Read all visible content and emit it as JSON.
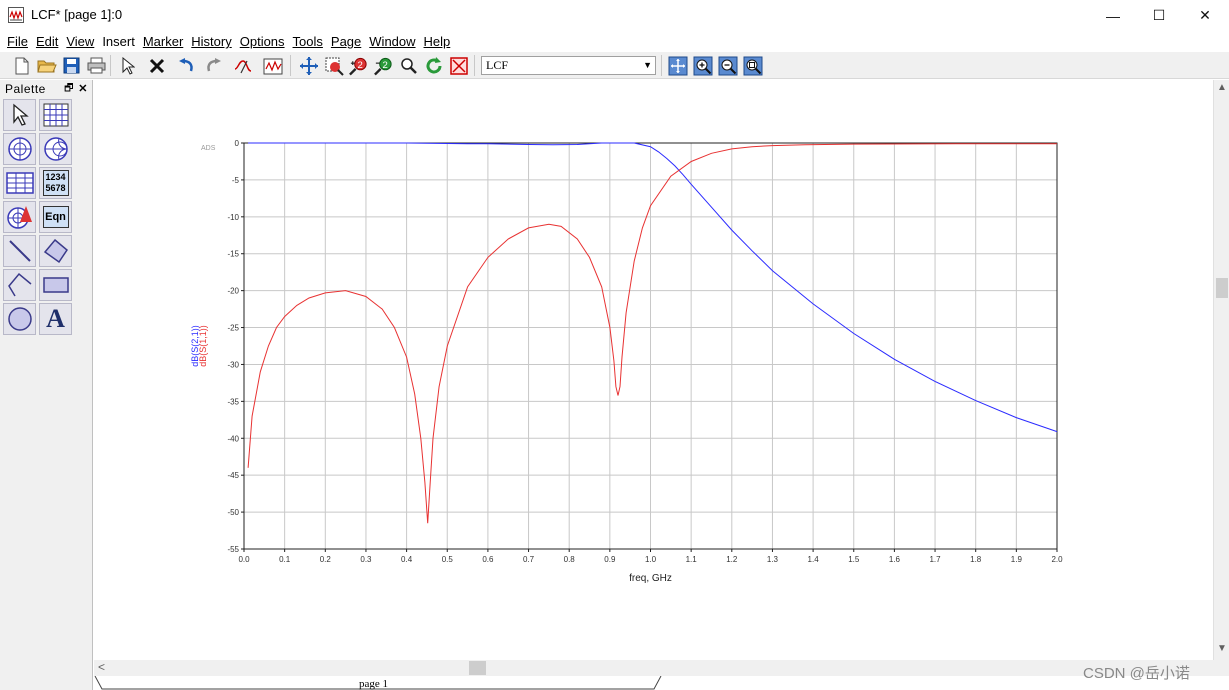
{
  "window": {
    "title": "LCF* [page 1]:0",
    "controls": {
      "minimize": "—",
      "maximize": "☐",
      "close": "✕"
    }
  },
  "menu": [
    {
      "label": "File"
    },
    {
      "label": "Edit"
    },
    {
      "label": "View"
    },
    {
      "label": "Insert"
    },
    {
      "label": "Marker"
    },
    {
      "label": "History"
    },
    {
      "label": "Options"
    },
    {
      "label": "Tools"
    },
    {
      "label": "Page"
    },
    {
      "label": "Window"
    },
    {
      "label": "Help"
    }
  ],
  "toolbar": {
    "page_select_value": "LCF",
    "buttons": [
      "new-icon",
      "open-icon",
      "save-icon",
      "print-icon",
      "select-pointer-icon",
      "delete-icon",
      "undo-icon",
      "redo-icon",
      "marker-icon",
      "plot-icon",
      "move-icon",
      "zoom-area-icon",
      "zoom-in-2-icon",
      "zoom-out-2-icon",
      "zoom-search-icon",
      "refresh-icon",
      "clear-icon",
      "view-all-icon",
      "zoom-in-icon",
      "zoom-out-icon",
      "zoom-fit-icon"
    ]
  },
  "palette": {
    "title": "Palette",
    "pin": "🗗",
    "close": "✕",
    "items": [
      {
        "name": "pointer-tool-icon"
      },
      {
        "name": "rectangular-plot-icon"
      },
      {
        "name": "polar-plot-icon"
      },
      {
        "name": "smith-chart-icon"
      },
      {
        "name": "list-table-icon"
      },
      {
        "name": "stacked-list-icon",
        "text": [
          "1234",
          "5678"
        ]
      },
      {
        "name": "antenna-plot-icon"
      },
      {
        "name": "equation-icon",
        "text": "Eqn"
      },
      {
        "name": "line-tool-icon"
      },
      {
        "name": "polygon-tool-icon"
      },
      {
        "name": "polyline-tool-icon"
      },
      {
        "name": "rectangle-tool-icon"
      },
      {
        "name": "circle-tool-icon"
      },
      {
        "name": "text-tool-icon",
        "text": "A"
      }
    ]
  },
  "scroll": {
    "up": "▲",
    "down": "▼",
    "left": "<"
  },
  "tabs": [
    {
      "label": "page 1"
    }
  ],
  "watermark": "CSDN @岳小诺",
  "colors": {
    "s21": "#2b2bff",
    "s11": "#e83232",
    "grid": "#c8c8c8"
  },
  "chart_data": {
    "type": "line",
    "corner_label": "ADS",
    "xlabel": "freq, GHz",
    "ylabel_series": [
      "dB(S(2,1))",
      "dB(S(1,1))"
    ],
    "xlim": [
      0.0,
      2.0
    ],
    "ylim": [
      -55,
      0
    ],
    "x_ticks": [
      "0.0",
      "0.1",
      "0.2",
      "0.3",
      "0.4",
      "0.5",
      "0.6",
      "0.7",
      "0.8",
      "0.9",
      "1.0",
      "1.1",
      "1.2",
      "1.3",
      "1.4",
      "1.5",
      "1.6",
      "1.7",
      "1.8",
      "1.9",
      "2.0"
    ],
    "y_ticks": [
      "0",
      "-5",
      "-10",
      "-15",
      "-20",
      "-25",
      "-30",
      "-35",
      "-40",
      "-45",
      "-50",
      "-55"
    ],
    "grid": true,
    "series": [
      {
        "name": "dB(S(2,1))",
        "color": "#2b2bff",
        "x": [
          0.01,
          0.2,
          0.4,
          0.55,
          0.6,
          0.7,
          0.76,
          0.82,
          0.88,
          0.92,
          0.96,
          1.0,
          1.02,
          1.04,
          1.06,
          1.08,
          1.1,
          1.15,
          1.2,
          1.25,
          1.3,
          1.4,
          1.5,
          1.6,
          1.7,
          1.8,
          1.9,
          2.0
        ],
        "y": [
          0,
          0,
          0,
          -0.1,
          -0.1,
          -0.2,
          -0.25,
          -0.2,
          0,
          0,
          0,
          -0.5,
          -1.2,
          -2.1,
          -3.1,
          -4.3,
          -5.6,
          -8.7,
          -11.8,
          -14.6,
          -17.3,
          -21.8,
          -25.8,
          -29.3,
          -32.3,
          -34.9,
          -37.2,
          -39.1
        ]
      },
      {
        "name": "dB(S(1,1))",
        "color": "#e83232",
        "x": [
          0.01,
          0.02,
          0.04,
          0.06,
          0.08,
          0.1,
          0.13,
          0.16,
          0.2,
          0.25,
          0.3,
          0.34,
          0.37,
          0.4,
          0.42,
          0.435,
          0.445,
          0.452,
          0.458,
          0.465,
          0.48,
          0.5,
          0.55,
          0.6,
          0.65,
          0.7,
          0.75,
          0.78,
          0.82,
          0.85,
          0.88,
          0.9,
          0.91,
          0.915,
          0.92,
          0.925,
          0.93,
          0.94,
          0.96,
          0.98,
          1.0,
          1.05,
          1.1,
          1.15,
          1.2,
          1.25,
          1.3,
          1.38,
          1.5,
          1.75,
          2.0
        ],
        "y": [
          -44,
          -37,
          -31,
          -27.5,
          -25,
          -23.5,
          -22,
          -21,
          -20.3,
          -20,
          -20.8,
          -22.5,
          -25,
          -29,
          -34,
          -40,
          -46,
          -51.5,
          -46,
          -40,
          -33,
          -27.5,
          -19.5,
          -15.5,
          -13,
          -11.5,
          -11,
          -11.3,
          -13,
          -15.5,
          -19.5,
          -25,
          -29.5,
          -33,
          -34.2,
          -33,
          -29,
          -23,
          -16,
          -11.5,
          -8.5,
          -4.5,
          -2.5,
          -1.4,
          -0.8,
          -0.5,
          -0.35,
          -0.25,
          -0.15,
          -0.1,
          -0.1
        ]
      }
    ]
  }
}
